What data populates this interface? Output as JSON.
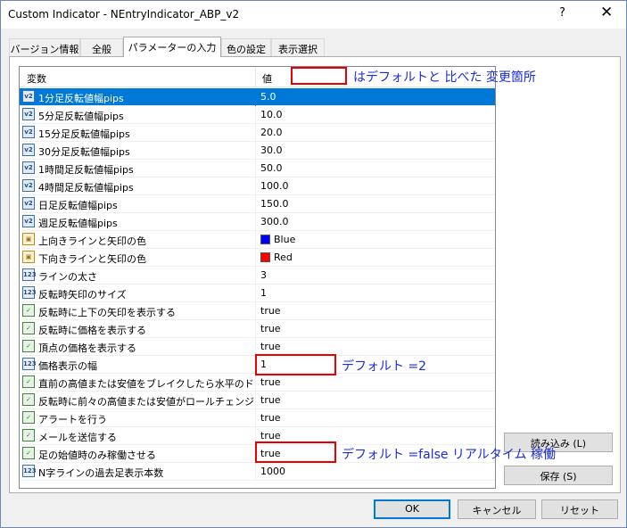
{
  "window": {
    "title": "Custom Indicator - NEntryIndicator_ABP_v2",
    "help": "?",
    "close": "✕"
  },
  "tabs": [
    {
      "label": "バージョン情報"
    },
    {
      "label": "全般"
    },
    {
      "label": "パラメーターの入力"
    },
    {
      "label": "色の設定"
    },
    {
      "label": "表示選択"
    }
  ],
  "grid": {
    "header_name": "変数",
    "header_value": "値",
    "rows": [
      {
        "type": "double",
        "name": "1分足反転値幅pips",
        "value": "5.0"
      },
      {
        "type": "double",
        "name": "5分足反転値幅pips",
        "value": "10.0"
      },
      {
        "type": "double",
        "name": "15分足反転値幅pips",
        "value": "20.0"
      },
      {
        "type": "double",
        "name": "30分足反転値幅pips",
        "value": "30.0"
      },
      {
        "type": "double",
        "name": "1時間足反転値幅pips",
        "value": "50.0"
      },
      {
        "type": "double",
        "name": "4時間足反転値幅pips",
        "value": "100.0"
      },
      {
        "type": "double",
        "name": "日足反転値幅pips",
        "value": "150.0"
      },
      {
        "type": "double",
        "name": "週足反転値幅pips",
        "value": "300.0"
      },
      {
        "type": "color",
        "name": "上向きラインと矢印の色",
        "value": "Blue",
        "swatch": "#0000ff"
      },
      {
        "type": "color",
        "name": "下向きラインと矢印の色",
        "value": "Red",
        "swatch": "#ff0000"
      },
      {
        "type": "int",
        "name": "ラインの太さ",
        "value": "3"
      },
      {
        "type": "int",
        "name": "反転時矢印のサイズ",
        "value": "1"
      },
      {
        "type": "bool",
        "name": "反転時に上下の矢印を表示する",
        "value": "true"
      },
      {
        "type": "bool",
        "name": "反転時に価格を表示する",
        "value": "true"
      },
      {
        "type": "bool",
        "name": "頂点の価格を表示する",
        "value": "true"
      },
      {
        "type": "int",
        "name": "価格表示の幅",
        "value": "1"
      },
      {
        "type": "bool",
        "name": "直前の高値または安値をブレイクしたら水平のドッ...",
        "value": "true"
      },
      {
        "type": "bool",
        "name": "反転時に前々の高値または安値がロールチェンジ...",
        "value": "true"
      },
      {
        "type": "bool",
        "name": "アラートを行う",
        "value": "true"
      },
      {
        "type": "bool",
        "name": "メールを送信する",
        "value": "true"
      },
      {
        "type": "bool",
        "name": "足の始値時のみ稼働させる",
        "value": "true"
      },
      {
        "type": "int",
        "name": "N字ラインの過去足表示本数",
        "value": "1000"
      }
    ]
  },
  "buttons": {
    "load": "読み込み (L)",
    "save": "保存 (S)",
    "ok": "OK",
    "cancel": "キャンセル",
    "reset": "リセット"
  },
  "annotations": {
    "legend": "はデフォルトと 比べた 変更箇所",
    "width_note": "デフォルト =2",
    "start_note": "デフォルト =false リアルタイム 稼働"
  },
  "icons": {
    "double": "v2",
    "int": "123",
    "bool": "bool-check-icon",
    "color": "palette-icon"
  },
  "colors": {
    "selection": "#0078d7",
    "annotation_red": "#e60000",
    "annotation_blue": "#1a2cd6"
  }
}
